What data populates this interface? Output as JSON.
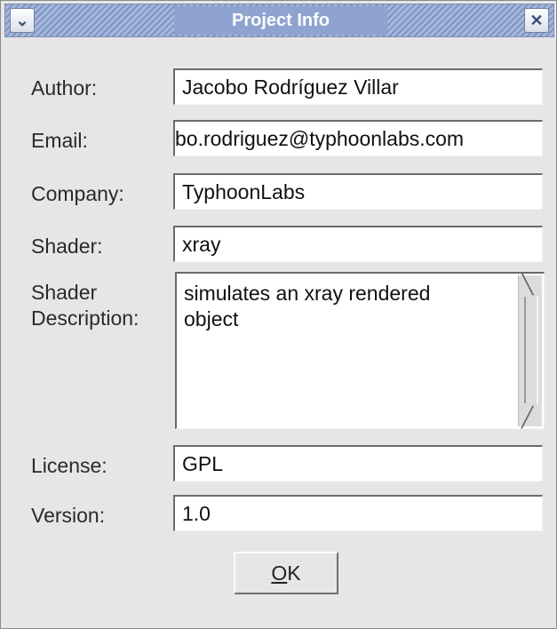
{
  "window": {
    "title": "Project Info",
    "menu_icon": "chevron-down-icon",
    "close_icon": "close-icon",
    "title_color": "#8ea3cf"
  },
  "form": {
    "author": {
      "label": "Author:",
      "value": "Jacobo Rodríguez Villar"
    },
    "email": {
      "label": "Email:",
      "value": "bo.rodriguez@typhoonlabs.com"
    },
    "company": {
      "label": "Company:",
      "value": "TyphoonLabs"
    },
    "shader": {
      "label": "Shader:",
      "value": "xray"
    },
    "shader_description": {
      "label_line1": "Shader",
      "label_line2": "Description:",
      "value": "simulates an xray rendered\nobject"
    },
    "license": {
      "label": "License:",
      "value": "GPL"
    },
    "version": {
      "label": "Version:",
      "value": "1.0"
    }
  },
  "buttons": {
    "ok_mnemonic": "O",
    "ok_rest": "K"
  }
}
